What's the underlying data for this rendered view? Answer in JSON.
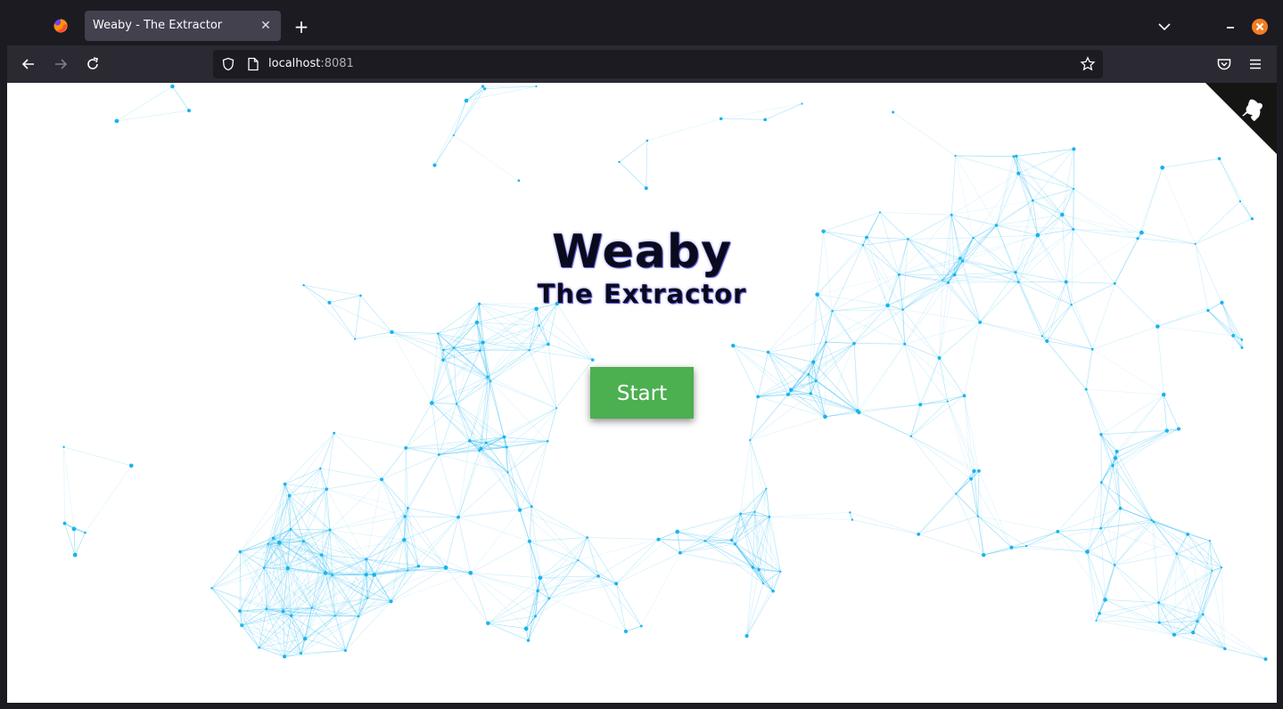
{
  "browser": {
    "tab_title": "Weaby - The Extractor",
    "url_host": "localhost",
    "url_port": ":8081",
    "icons": {
      "logo": "firefox-logo-icon",
      "tab_close": "close-icon",
      "new_tab": "plus-icon",
      "list_tabs": "chevron-down-icon",
      "minimize": "minimize-icon",
      "close_window": "close-icon",
      "back": "arrow-left-icon",
      "forward": "arrow-right-icon",
      "reload": "reload-icon",
      "tracking": "shield-icon",
      "page": "page-icon",
      "bookmark": "star-icon",
      "pocket": "pocket-icon",
      "menu": "hamburger-menu-icon"
    }
  },
  "page": {
    "title": "Weaby",
    "subtitle": "The Extractor",
    "start_label": "Start",
    "github_icon": "github-octocat-icon",
    "colors": {
      "accent_button": "#4caf50",
      "particle": "#18b4ee",
      "title_text": "#0a0a1e"
    }
  }
}
